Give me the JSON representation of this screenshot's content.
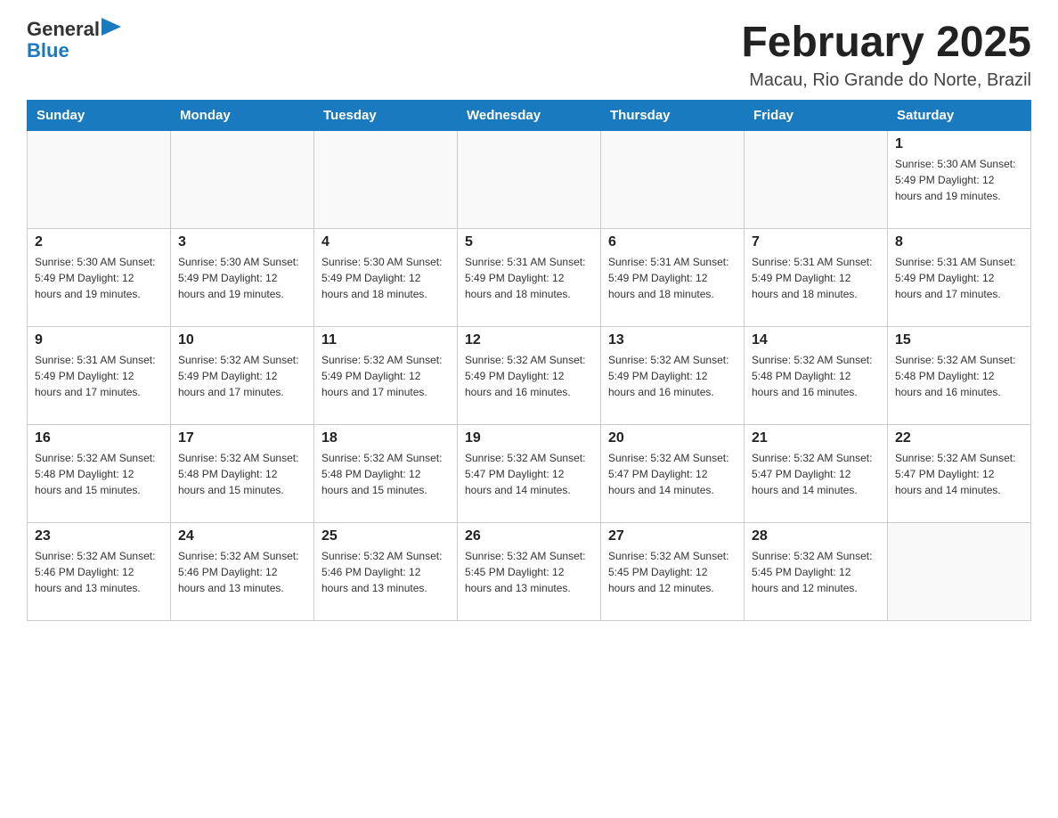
{
  "header": {
    "logo": {
      "general": "General",
      "blue": "Blue",
      "arrow": "▶"
    },
    "title": "February 2025",
    "subtitle": "Macau, Rio Grande do Norte, Brazil"
  },
  "weekdays": [
    "Sunday",
    "Monday",
    "Tuesday",
    "Wednesday",
    "Thursday",
    "Friday",
    "Saturday"
  ],
  "weeks": [
    [
      {
        "day": "",
        "info": ""
      },
      {
        "day": "",
        "info": ""
      },
      {
        "day": "",
        "info": ""
      },
      {
        "day": "",
        "info": ""
      },
      {
        "day": "",
        "info": ""
      },
      {
        "day": "",
        "info": ""
      },
      {
        "day": "1",
        "info": "Sunrise: 5:30 AM\nSunset: 5:49 PM\nDaylight: 12 hours and 19 minutes."
      }
    ],
    [
      {
        "day": "2",
        "info": "Sunrise: 5:30 AM\nSunset: 5:49 PM\nDaylight: 12 hours and 19 minutes."
      },
      {
        "day": "3",
        "info": "Sunrise: 5:30 AM\nSunset: 5:49 PM\nDaylight: 12 hours and 19 minutes."
      },
      {
        "day": "4",
        "info": "Sunrise: 5:30 AM\nSunset: 5:49 PM\nDaylight: 12 hours and 18 minutes."
      },
      {
        "day": "5",
        "info": "Sunrise: 5:31 AM\nSunset: 5:49 PM\nDaylight: 12 hours and 18 minutes."
      },
      {
        "day": "6",
        "info": "Sunrise: 5:31 AM\nSunset: 5:49 PM\nDaylight: 12 hours and 18 minutes."
      },
      {
        "day": "7",
        "info": "Sunrise: 5:31 AM\nSunset: 5:49 PM\nDaylight: 12 hours and 18 minutes."
      },
      {
        "day": "8",
        "info": "Sunrise: 5:31 AM\nSunset: 5:49 PM\nDaylight: 12 hours and 17 minutes."
      }
    ],
    [
      {
        "day": "9",
        "info": "Sunrise: 5:31 AM\nSunset: 5:49 PM\nDaylight: 12 hours and 17 minutes."
      },
      {
        "day": "10",
        "info": "Sunrise: 5:32 AM\nSunset: 5:49 PM\nDaylight: 12 hours and 17 minutes."
      },
      {
        "day": "11",
        "info": "Sunrise: 5:32 AM\nSunset: 5:49 PM\nDaylight: 12 hours and 17 minutes."
      },
      {
        "day": "12",
        "info": "Sunrise: 5:32 AM\nSunset: 5:49 PM\nDaylight: 12 hours and 16 minutes."
      },
      {
        "day": "13",
        "info": "Sunrise: 5:32 AM\nSunset: 5:49 PM\nDaylight: 12 hours and 16 minutes."
      },
      {
        "day": "14",
        "info": "Sunrise: 5:32 AM\nSunset: 5:48 PM\nDaylight: 12 hours and 16 minutes."
      },
      {
        "day": "15",
        "info": "Sunrise: 5:32 AM\nSunset: 5:48 PM\nDaylight: 12 hours and 16 minutes."
      }
    ],
    [
      {
        "day": "16",
        "info": "Sunrise: 5:32 AM\nSunset: 5:48 PM\nDaylight: 12 hours and 15 minutes."
      },
      {
        "day": "17",
        "info": "Sunrise: 5:32 AM\nSunset: 5:48 PM\nDaylight: 12 hours and 15 minutes."
      },
      {
        "day": "18",
        "info": "Sunrise: 5:32 AM\nSunset: 5:48 PM\nDaylight: 12 hours and 15 minutes."
      },
      {
        "day": "19",
        "info": "Sunrise: 5:32 AM\nSunset: 5:47 PM\nDaylight: 12 hours and 14 minutes."
      },
      {
        "day": "20",
        "info": "Sunrise: 5:32 AM\nSunset: 5:47 PM\nDaylight: 12 hours and 14 minutes."
      },
      {
        "day": "21",
        "info": "Sunrise: 5:32 AM\nSunset: 5:47 PM\nDaylight: 12 hours and 14 minutes."
      },
      {
        "day": "22",
        "info": "Sunrise: 5:32 AM\nSunset: 5:47 PM\nDaylight: 12 hours and 14 minutes."
      }
    ],
    [
      {
        "day": "23",
        "info": "Sunrise: 5:32 AM\nSunset: 5:46 PM\nDaylight: 12 hours and 13 minutes."
      },
      {
        "day": "24",
        "info": "Sunrise: 5:32 AM\nSunset: 5:46 PM\nDaylight: 12 hours and 13 minutes."
      },
      {
        "day": "25",
        "info": "Sunrise: 5:32 AM\nSunset: 5:46 PM\nDaylight: 12 hours and 13 minutes."
      },
      {
        "day": "26",
        "info": "Sunrise: 5:32 AM\nSunset: 5:45 PM\nDaylight: 12 hours and 13 minutes."
      },
      {
        "day": "27",
        "info": "Sunrise: 5:32 AM\nSunset: 5:45 PM\nDaylight: 12 hours and 12 minutes."
      },
      {
        "day": "28",
        "info": "Sunrise: 5:32 AM\nSunset: 5:45 PM\nDaylight: 12 hours and 12 minutes."
      },
      {
        "day": "",
        "info": ""
      }
    ]
  ]
}
